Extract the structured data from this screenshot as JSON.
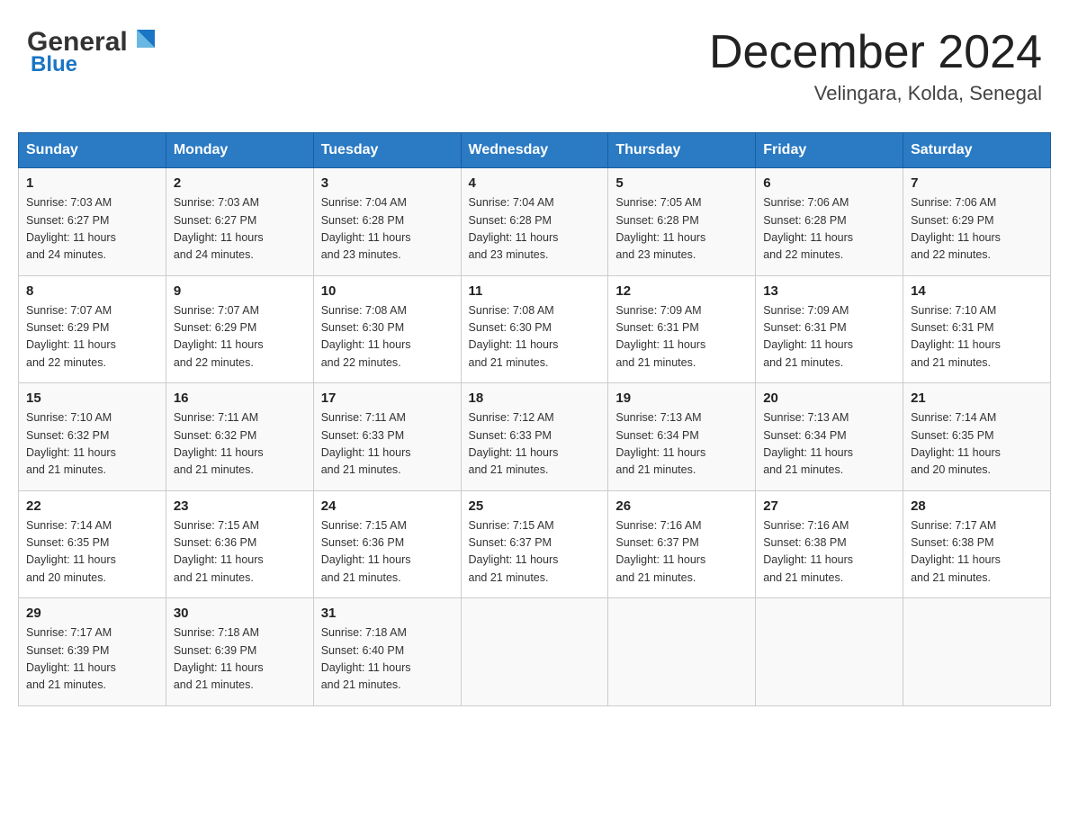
{
  "header": {
    "logo_general": "General",
    "logo_blue": "Blue",
    "month_title": "December 2024",
    "location": "Velingara, Kolda, Senegal"
  },
  "days_of_week": [
    "Sunday",
    "Monday",
    "Tuesday",
    "Wednesday",
    "Thursday",
    "Friday",
    "Saturday"
  ],
  "weeks": [
    [
      {
        "num": "1",
        "sunrise": "7:03 AM",
        "sunset": "6:27 PM",
        "daylight": "11 hours and 24 minutes."
      },
      {
        "num": "2",
        "sunrise": "7:03 AM",
        "sunset": "6:27 PM",
        "daylight": "11 hours and 24 minutes."
      },
      {
        "num": "3",
        "sunrise": "7:04 AM",
        "sunset": "6:28 PM",
        "daylight": "11 hours and 23 minutes."
      },
      {
        "num": "4",
        "sunrise": "7:04 AM",
        "sunset": "6:28 PM",
        "daylight": "11 hours and 23 minutes."
      },
      {
        "num": "5",
        "sunrise": "7:05 AM",
        "sunset": "6:28 PM",
        "daylight": "11 hours and 23 minutes."
      },
      {
        "num": "6",
        "sunrise": "7:06 AM",
        "sunset": "6:28 PM",
        "daylight": "11 hours and 22 minutes."
      },
      {
        "num": "7",
        "sunrise": "7:06 AM",
        "sunset": "6:29 PM",
        "daylight": "11 hours and 22 minutes."
      }
    ],
    [
      {
        "num": "8",
        "sunrise": "7:07 AM",
        "sunset": "6:29 PM",
        "daylight": "11 hours and 22 minutes."
      },
      {
        "num": "9",
        "sunrise": "7:07 AM",
        "sunset": "6:29 PM",
        "daylight": "11 hours and 22 minutes."
      },
      {
        "num": "10",
        "sunrise": "7:08 AM",
        "sunset": "6:30 PM",
        "daylight": "11 hours and 22 minutes."
      },
      {
        "num": "11",
        "sunrise": "7:08 AM",
        "sunset": "6:30 PM",
        "daylight": "11 hours and 21 minutes."
      },
      {
        "num": "12",
        "sunrise": "7:09 AM",
        "sunset": "6:31 PM",
        "daylight": "11 hours and 21 minutes."
      },
      {
        "num": "13",
        "sunrise": "7:09 AM",
        "sunset": "6:31 PM",
        "daylight": "11 hours and 21 minutes."
      },
      {
        "num": "14",
        "sunrise": "7:10 AM",
        "sunset": "6:31 PM",
        "daylight": "11 hours and 21 minutes."
      }
    ],
    [
      {
        "num": "15",
        "sunrise": "7:10 AM",
        "sunset": "6:32 PM",
        "daylight": "11 hours and 21 minutes."
      },
      {
        "num": "16",
        "sunrise": "7:11 AM",
        "sunset": "6:32 PM",
        "daylight": "11 hours and 21 minutes."
      },
      {
        "num": "17",
        "sunrise": "7:11 AM",
        "sunset": "6:33 PM",
        "daylight": "11 hours and 21 minutes."
      },
      {
        "num": "18",
        "sunrise": "7:12 AM",
        "sunset": "6:33 PM",
        "daylight": "11 hours and 21 minutes."
      },
      {
        "num": "19",
        "sunrise": "7:13 AM",
        "sunset": "6:34 PM",
        "daylight": "11 hours and 21 minutes."
      },
      {
        "num": "20",
        "sunrise": "7:13 AM",
        "sunset": "6:34 PM",
        "daylight": "11 hours and 21 minutes."
      },
      {
        "num": "21",
        "sunrise": "7:14 AM",
        "sunset": "6:35 PM",
        "daylight": "11 hours and 20 minutes."
      }
    ],
    [
      {
        "num": "22",
        "sunrise": "7:14 AM",
        "sunset": "6:35 PM",
        "daylight": "11 hours and 20 minutes."
      },
      {
        "num": "23",
        "sunrise": "7:15 AM",
        "sunset": "6:36 PM",
        "daylight": "11 hours and 21 minutes."
      },
      {
        "num": "24",
        "sunrise": "7:15 AM",
        "sunset": "6:36 PM",
        "daylight": "11 hours and 21 minutes."
      },
      {
        "num": "25",
        "sunrise": "7:15 AM",
        "sunset": "6:37 PM",
        "daylight": "11 hours and 21 minutes."
      },
      {
        "num": "26",
        "sunrise": "7:16 AM",
        "sunset": "6:37 PM",
        "daylight": "11 hours and 21 minutes."
      },
      {
        "num": "27",
        "sunrise": "7:16 AM",
        "sunset": "6:38 PM",
        "daylight": "11 hours and 21 minutes."
      },
      {
        "num": "28",
        "sunrise": "7:17 AM",
        "sunset": "6:38 PM",
        "daylight": "11 hours and 21 minutes."
      }
    ],
    [
      {
        "num": "29",
        "sunrise": "7:17 AM",
        "sunset": "6:39 PM",
        "daylight": "11 hours and 21 minutes."
      },
      {
        "num": "30",
        "sunrise": "7:18 AM",
        "sunset": "6:39 PM",
        "daylight": "11 hours and 21 minutes."
      },
      {
        "num": "31",
        "sunrise": "7:18 AM",
        "sunset": "6:40 PM",
        "daylight": "11 hours and 21 minutes."
      },
      null,
      null,
      null,
      null
    ]
  ],
  "labels": {
    "sunrise": "Sunrise:",
    "sunset": "Sunset:",
    "daylight": "Daylight:"
  }
}
